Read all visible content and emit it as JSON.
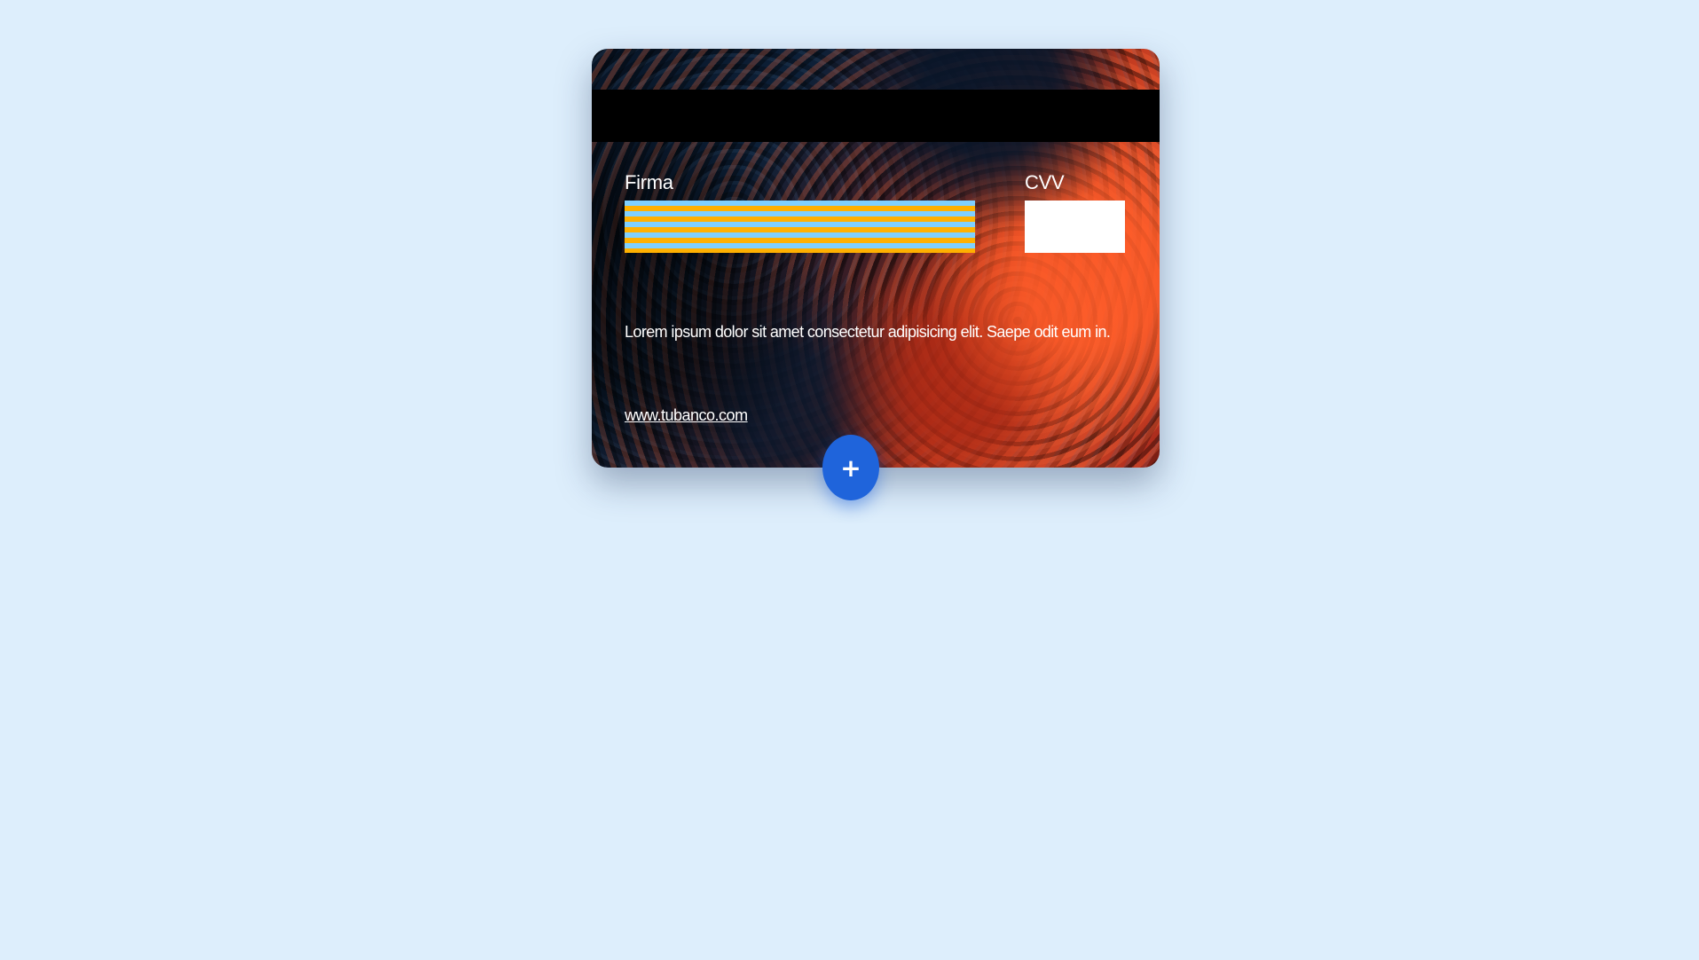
{
  "card": {
    "signature_label": "Firma",
    "cvv_label": "CVV",
    "cvv_value": "",
    "description": "Lorem ipsum dolor sit amet consectetur adipisicing elit. Saepe odit eum in.",
    "website": "www.tubanco.com"
  },
  "actions": {
    "flip_button_icon": "+",
    "flip_button_icon_name": "plus-icon"
  },
  "colors": {
    "background": "#ddeefc",
    "button": "#1f64db",
    "stripe_blue": "#7fd0ff",
    "stripe_orange": "#ffb000"
  }
}
